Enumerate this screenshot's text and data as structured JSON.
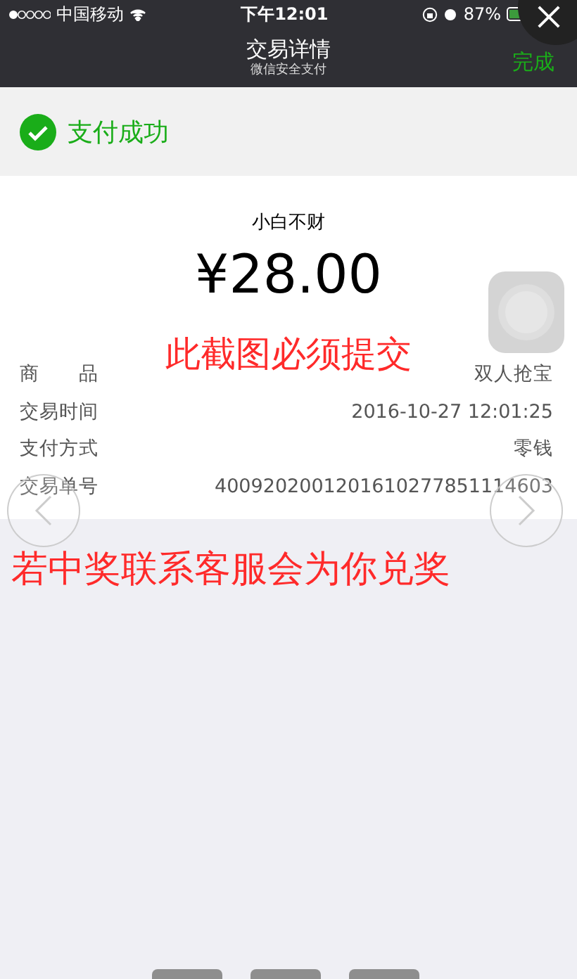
{
  "status_bar": {
    "carrier": "中国移动",
    "time": "下午12:01",
    "battery": "87%"
  },
  "nav_bar": {
    "title": "交易详情",
    "subtitle": "微信安全支付",
    "done": "完成"
  },
  "result": {
    "text": "支付成功"
  },
  "payment": {
    "merchant": "小白不财",
    "amount": "¥28.00"
  },
  "annotations": [
    "此截图必须提交",
    "若中奖联系客服会为你兑奖"
  ],
  "details": [
    {
      "label": "商　　品",
      "value": "双人抢宝"
    },
    {
      "label": "交易时间",
      "value": "2016-10-27 12:01:25"
    },
    {
      "label": "支付方式",
      "value": "零钱"
    },
    {
      "label": "交易单号",
      "value": "4009202001201610277851114603"
    }
  ]
}
